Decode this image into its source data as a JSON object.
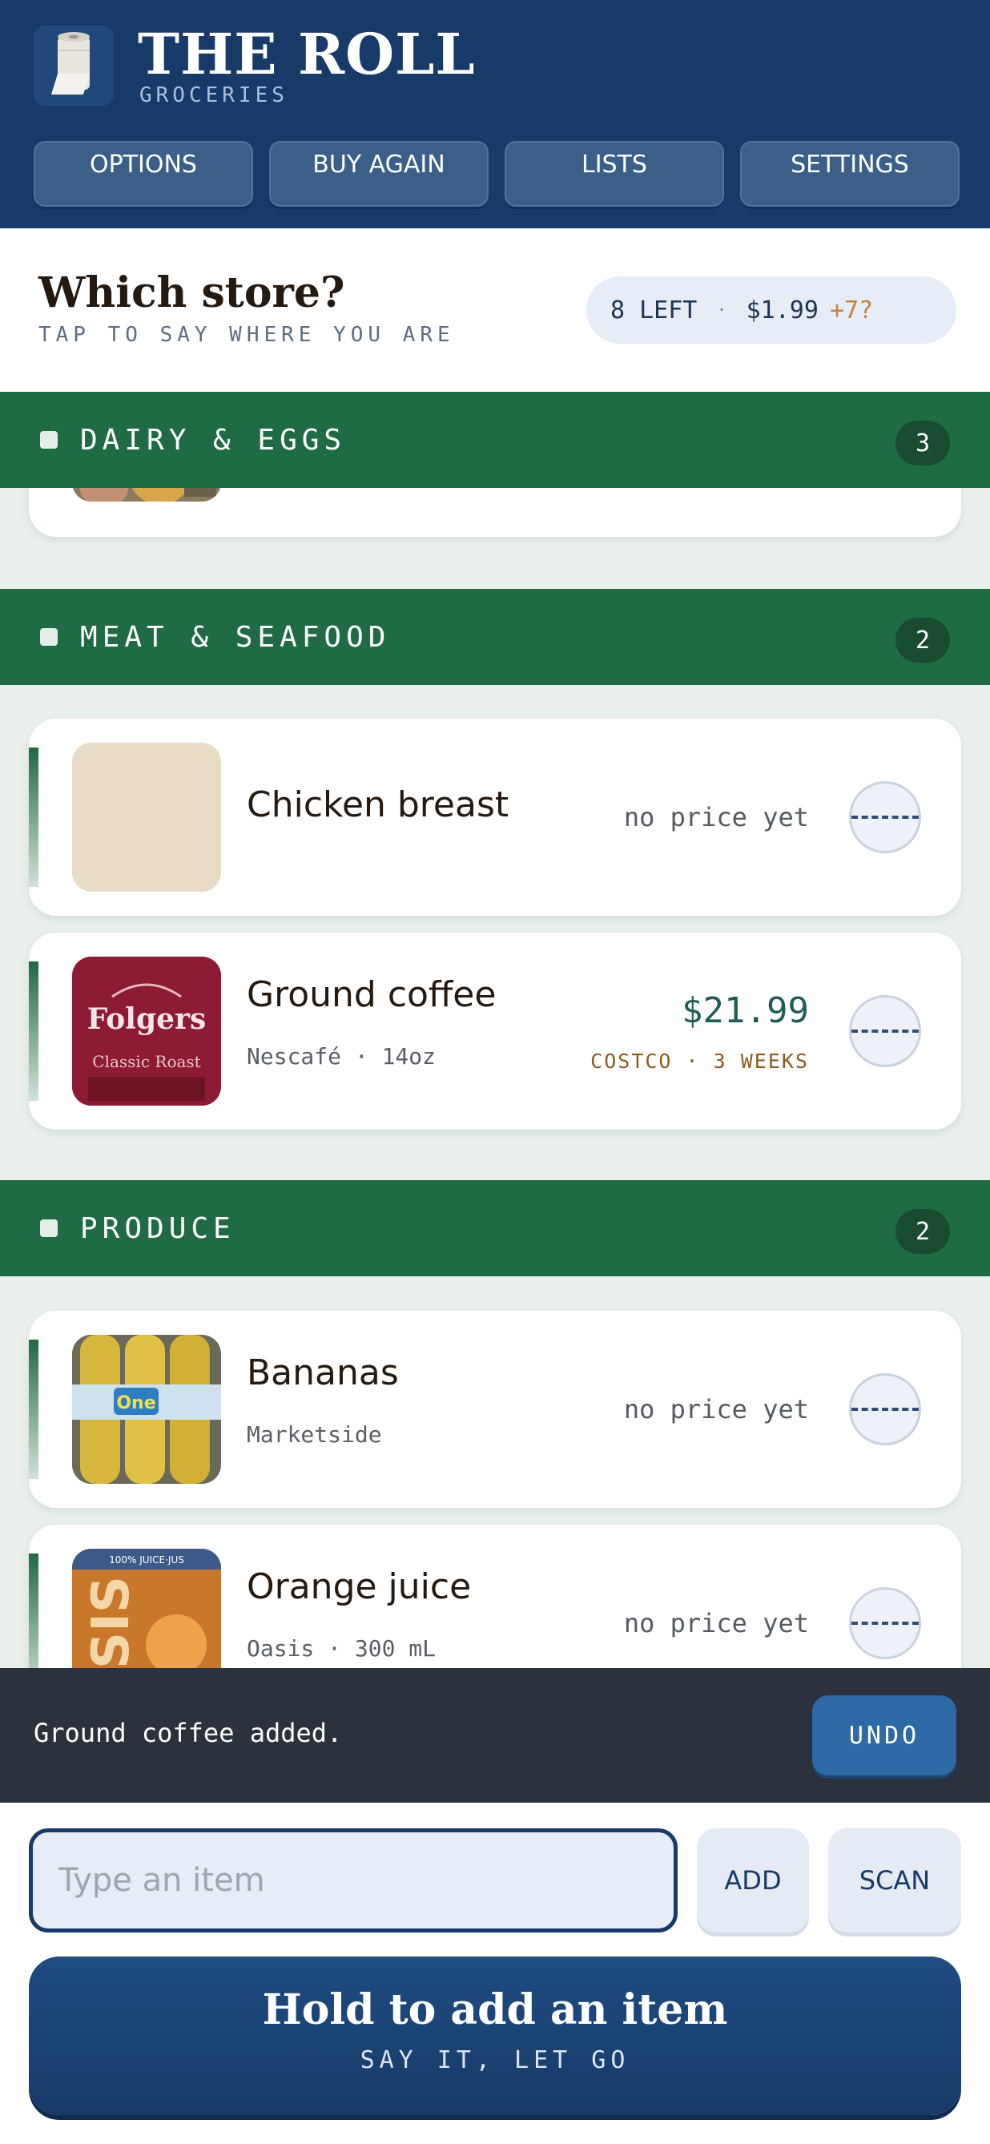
{
  "header": {
    "title": "THE ROLL",
    "subtitle": "GROCERIES",
    "nav": [
      "OPTIONS",
      "BUY AGAIN",
      "LISTS",
      "SETTINGS"
    ]
  },
  "store": {
    "title": "Which store?",
    "subtitle": "TAP TO SAY WHERE YOU ARE",
    "remaining": "8 LEFT",
    "separator": "·",
    "total": "$1.99",
    "extra": "+7?"
  },
  "categories": [
    {
      "name": "DAIRY & EGGS",
      "count": "3"
    },
    {
      "name": "MEAT & SEAFOOD",
      "count": "2"
    },
    {
      "name": "PRODUCE",
      "count": "2"
    }
  ],
  "items": {
    "chicken": {
      "name": "Chicken breast",
      "price": "no price yet"
    },
    "coffee": {
      "name": "Ground coffee",
      "detail": "Nescafé · 14oz",
      "price": "$21.99",
      "meta": "COSTCO · 3 WEEKS",
      "thumb_text_1": "Folgers",
      "thumb_text_2": "Classic Roast"
    },
    "bananas": {
      "name": "Bananas",
      "detail": "Marketside",
      "price": "no price yet",
      "thumb_text": "One"
    },
    "oj": {
      "name": "Orange juice",
      "detail": "Oasis · 300 mL",
      "price": "no price yet",
      "thumb_text_1": "100% JUICE·JUS",
      "thumb_text_2": "SIS"
    }
  },
  "toast": {
    "message": "Ground coffee added.",
    "action": "UNDO"
  },
  "input": {
    "placeholder": "Type an item",
    "add_label": "ADD",
    "scan_label": "SCAN"
  },
  "hold": {
    "title": "Hold to add an item",
    "subtitle": "SAY IT, LET GO"
  },
  "colors": {
    "navy": "#173a68",
    "green": "#1f6b43",
    "price_green": "#1f5e57",
    "meta_brown": "#8a5c1d",
    "accent_orange": "#c7813d"
  }
}
